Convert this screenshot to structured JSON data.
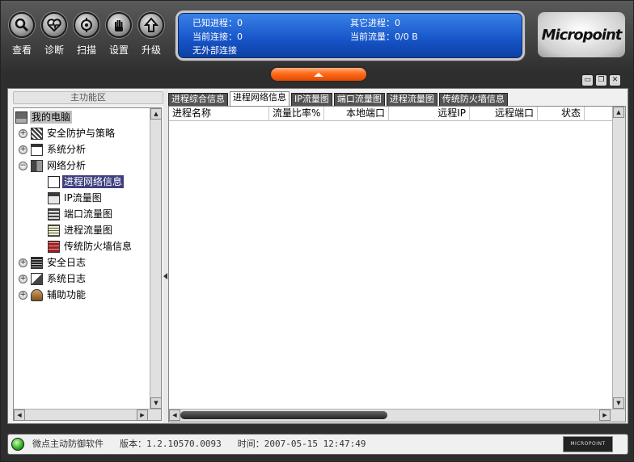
{
  "toolbar": {
    "buttons": [
      {
        "label": "查看",
        "icon": "magnifier-icon"
      },
      {
        "label": "诊断",
        "icon": "heart-icon"
      },
      {
        "label": "扫描",
        "icon": "scan-icon"
      },
      {
        "label": "设置",
        "icon": "hand-icon"
      },
      {
        "label": "升级",
        "icon": "upgrade-arrow-icon"
      }
    ]
  },
  "status_panel": {
    "known_processes": "已知进程：0",
    "other_processes": "其它进程：0",
    "current_connections": "当前连接：0",
    "current_traffic": "当前流量：0/0 B",
    "external_connections": "无外部连接"
  },
  "logo": {
    "text": "Micropoint"
  },
  "left_panel": {
    "title": "主功能区",
    "tree": {
      "root": "我的电脑",
      "security_policy": "安全防护与策略",
      "system_analysis": "系统分析",
      "network_analysis": "网络分析",
      "process_network_info": "进程网络信息",
      "ip_traffic_graph": "IP流量图",
      "port_traffic_graph": "端口流量图",
      "process_traffic_graph": "进程流量图",
      "firewall_info": "传统防火墙信息",
      "security_log": "安全日志",
      "system_log": "系统日志",
      "aux_functions": "辅助功能"
    }
  },
  "tabs": [
    "进程综合信息",
    "进程网络信息",
    "IP流量图",
    "端口流量图",
    "进程流量图",
    "传统防火墙信息"
  ],
  "active_tab": 1,
  "grid": {
    "columns": [
      "进程名称",
      "流量比率%",
      "本地端口",
      "远程IP",
      "远程端口",
      "状态"
    ]
  },
  "statusbar": {
    "product": "微点主动防御软件",
    "version_label": "版本：",
    "version": "1.2.10570.0093",
    "time_label": "时间：",
    "time": "2007-05-15 12:47:49",
    "logo": "MICROPOINT"
  },
  "colors": {
    "status_panel_blue": "#1654c8",
    "selected_item": "#404080",
    "orange_button": "#ff6a1c",
    "led_green": "#2caa1c"
  }
}
